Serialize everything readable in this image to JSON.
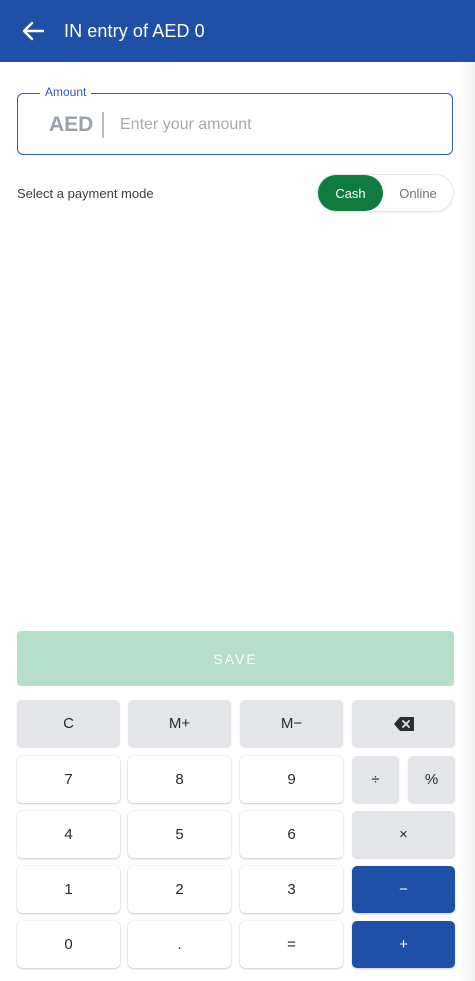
{
  "header": {
    "title": "IN entry of AED 0",
    "back_icon": "arrow-left-icon",
    "background": "#1f4fa6"
  },
  "amount": {
    "legend": "Amount",
    "currency": "AED",
    "placeholder": "Enter your amount",
    "value": ""
  },
  "payment_mode": {
    "label": "Select a payment mode",
    "options": [
      "Cash",
      "Online"
    ],
    "selected": "Cash",
    "selected_color": "#0e7b3f"
  },
  "save": {
    "label": "SAVE",
    "color": "#b5dfc8"
  },
  "keypad": {
    "row1": [
      "C",
      "M+",
      "M−",
      "backspace-icon"
    ],
    "row2": [
      "7",
      "8",
      "9",
      "÷",
      "%"
    ],
    "row3": [
      "4",
      "5",
      "6",
      "×"
    ],
    "row4": [
      "1",
      "2",
      "3",
      "−"
    ],
    "row5": [
      "0",
      ".",
      "=",
      "+"
    ],
    "accent": "#1f4fa6"
  }
}
